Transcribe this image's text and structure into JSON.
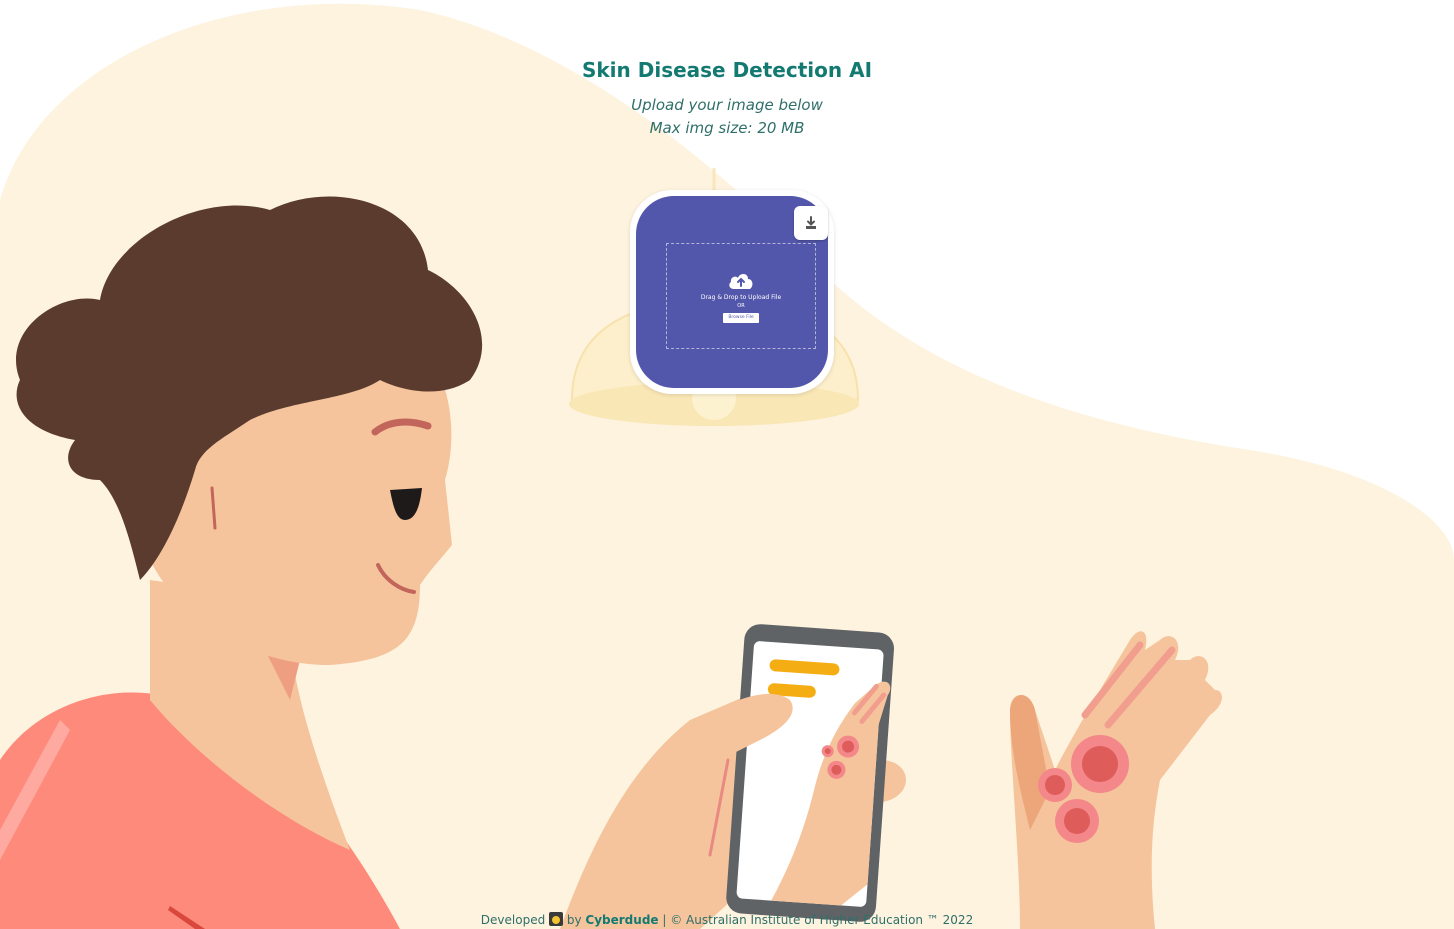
{
  "header": {
    "title": "Skin Disease Detection AI",
    "subtitle_line1": "Upload your image below",
    "subtitle_line2": "Max img size: 20 MB"
  },
  "uploader": {
    "download_icon": "download-icon",
    "upload_icon": "cloud-upload-icon",
    "drop_text": "Drag & Drop to Upload File",
    "or_text": "OR",
    "browse_label": "Browse File",
    "card_color": "#5357ab"
  },
  "footer": {
    "developed": "Developed",
    "emoji_icon": "emoji-icon",
    "by": "by",
    "author": "Cyberdude",
    "copyright": "| © Australian Institute of Higher Education ™ 2022"
  },
  "colors": {
    "accent": "#137a72",
    "background_blob": "#fdf3df",
    "skin": "#f5c49c",
    "hair": "#5a3b2e",
    "shirt": "#fe8a7c",
    "phone": "#5f6366",
    "highlight": "#f5ad14"
  }
}
